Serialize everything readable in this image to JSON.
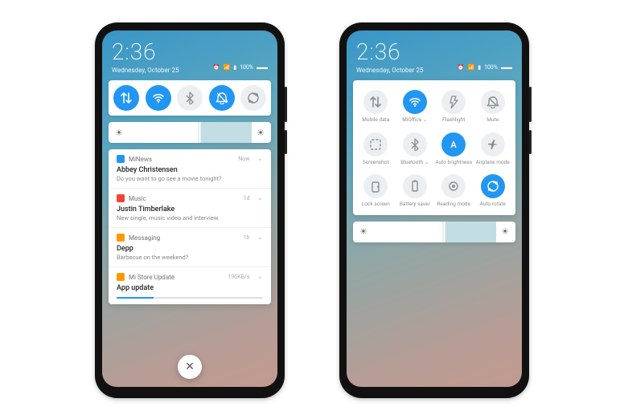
{
  "header": {
    "time": "2:36",
    "date": "Wednesday, October 25",
    "battery_pct": "100%"
  },
  "collapsed_toggles": [
    {
      "key": "data",
      "active": true
    },
    {
      "key": "wifi",
      "active": true
    },
    {
      "key": "bluetooth",
      "active": false
    },
    {
      "key": "dnd",
      "active": true
    },
    {
      "key": "rotate",
      "active": false
    }
  ],
  "brightness_pct": 58,
  "notifications": [
    {
      "app": "MiNews",
      "color": "#2196f3",
      "time": "Now",
      "title": "Abbey Christensen",
      "body": "Do you want to go see a movie tonight?"
    },
    {
      "app": "Music",
      "color": "#f44336",
      "time": "1d",
      "title": "Justin Timberlake",
      "body": "New single, music video and interview."
    },
    {
      "app": "Messaging",
      "color": "#ff9800",
      "time": "1h",
      "title": "Depp",
      "body": "Barbecue on the weekend?"
    },
    {
      "app": "Mi Store Update",
      "color": "#ff9800",
      "time": "",
      "title": "App update",
      "body": "",
      "progress": 25,
      "size": "196KB/s"
    }
  ],
  "expanded_toggles": [
    {
      "key": "data",
      "label": "Mobile data",
      "active": false
    },
    {
      "key": "wifi",
      "label": "MiOffice ⌄",
      "active": true
    },
    {
      "key": "flashlight",
      "label": "Flashlight",
      "active": false
    },
    {
      "key": "mute",
      "label": "Mute",
      "active": false
    },
    {
      "key": "screenshot",
      "label": "Screenshot",
      "active": false
    },
    {
      "key": "bluetooth",
      "label": "Bluetooth ⌄",
      "active": false
    },
    {
      "key": "autobright",
      "label": "Auto brightness",
      "active": true
    },
    {
      "key": "airplane",
      "label": "Airplane mode",
      "active": false
    },
    {
      "key": "lock",
      "label": "Lock screen",
      "active": false
    },
    {
      "key": "battery",
      "label": "Battery saver",
      "active": false
    },
    {
      "key": "reading",
      "label": "Reading mode",
      "active": false
    },
    {
      "key": "rotate",
      "label": "Auto-rotate",
      "active": true
    }
  ]
}
